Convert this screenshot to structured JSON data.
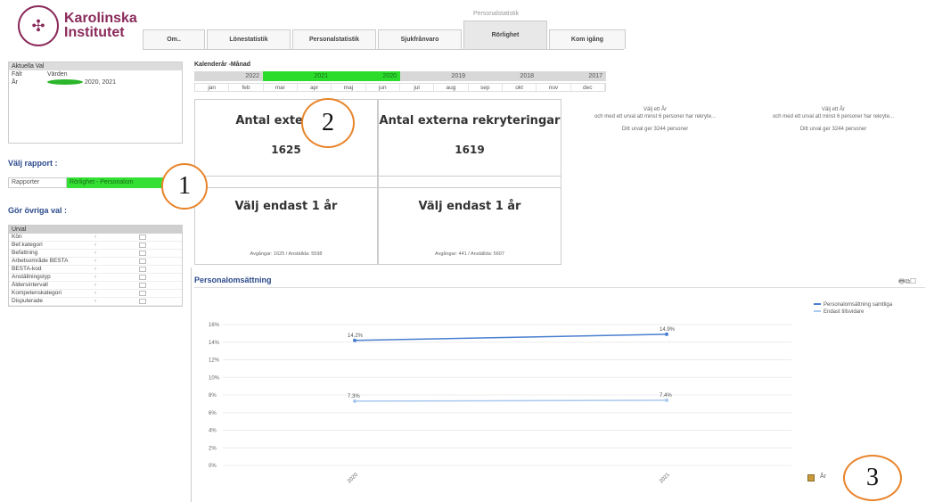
{
  "logo": {
    "line1": "Karolinska",
    "line2": "Institutet",
    "seal_glyph": "✣"
  },
  "tabs_caption": "Personalstatistik",
  "tabs": [
    {
      "label": "Om..",
      "active": false
    },
    {
      "label": "Lönestatistik",
      "active": false
    },
    {
      "label": "Personalstatistik",
      "active": false
    },
    {
      "label": "Sjukfrånvaro",
      "active": false
    },
    {
      "label": "Rörlighet",
      "active": true
    },
    {
      "label": "Kom igång",
      "active": false
    }
  ],
  "aktuella": {
    "title": "Aktuella Val",
    "col_field": "Fält",
    "col_values": "Värden",
    "row_field": "År",
    "row_value": "2020, 2021"
  },
  "rapport": {
    "section_title": "Välj rapport :",
    "label": "Rapporter",
    "value": "Rörlighet - Personalom"
  },
  "ovriga": {
    "section_title": "Gör övriga val :"
  },
  "urval": {
    "title": "Urval",
    "rows": [
      "Kön",
      "Bef.kategori",
      "Befattning",
      "Arbetsområde BESTA",
      "BESTA-kod",
      "Anställningstyp",
      "Åldersintervall",
      "Kompetenskategori",
      "Disputerade"
    ]
  },
  "calendar": {
    "title": "Kalenderår -Månad",
    "years": [
      {
        "label": "2022",
        "selected": false
      },
      {
        "label": "2021",
        "selected": true
      },
      {
        "label": "2020",
        "selected": true
      },
      {
        "label": "2019",
        "selected": false
      },
      {
        "label": "2018",
        "selected": false
      },
      {
        "label": "2017",
        "selected": false
      }
    ],
    "months": [
      "jan",
      "feb",
      "mar",
      "apr",
      "maj",
      "jun",
      "jul",
      "aug",
      "sep",
      "okt",
      "nov",
      "dec"
    ]
  },
  "kpis": {
    "ext_title": "Antal externa a",
    "ext_value": "1625",
    "rek_title": "Antal externa rekryteringar",
    "rek_value": "1619",
    "valj1": "Välj endast 1 år",
    "valj1_foot": "Avgångar: 1625 / Anställda: 5598",
    "valj2": "Välj endast 1 år",
    "valj2_foot": "Avgångar: 441 / Anställda: 5607"
  },
  "side_info": [
    {
      "l1": "Välj ett År",
      "l2": "och med ett urval att minst 6 personer har rekryte...",
      "l3": "Ditt urval ger 3244 personer"
    },
    {
      "l1": "Välj ett År",
      "l2": "och med ett urval att minst 6 personer har rekryte...",
      "l3": "Ditt urval ger 3244 personer"
    }
  ],
  "chart_section": {
    "title": "Personalomsättning",
    "icons": "🖶⧉☐",
    "bottom_label": "År"
  },
  "callouts": [
    "1",
    "2",
    "3"
  ],
  "chart_data": {
    "type": "line",
    "categories": [
      "2020",
      "2021"
    ],
    "series": [
      {
        "name": "Personalomsättning samtliga",
        "values": [
          14.2,
          14.9
        ],
        "labels": [
          "14.2%",
          "14.9%"
        ],
        "color": "#4a7fd0"
      },
      {
        "name": "Endast tillsvidare",
        "values": [
          7.3,
          7.4
        ],
        "labels": [
          "7.3%",
          "7.4%"
        ],
        "color": "#a9c8ee"
      }
    ],
    "yticks": [
      "16%",
      "14%",
      "12%",
      "10%",
      "8%",
      "6%",
      "4%",
      "2%",
      "0%"
    ],
    "ylim": [
      0,
      16
    ],
    "grid": true,
    "legend": "top-right"
  }
}
